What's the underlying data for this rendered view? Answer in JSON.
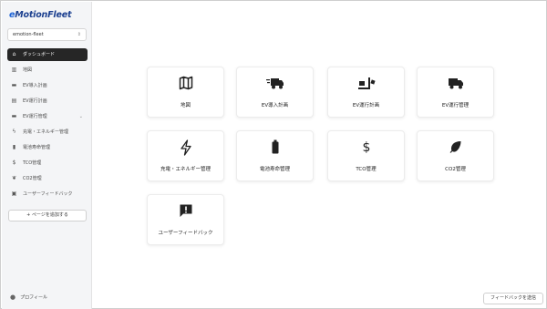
{
  "app": {
    "logo_e": "e",
    "logo_rest": "MotionFleet",
    "workspace": "emotion-fleet"
  },
  "sidebar": {
    "items": [
      {
        "label": "ダッシュボード",
        "icon": "home-icon",
        "active": true
      },
      {
        "label": "地図",
        "icon": "map-icon"
      },
      {
        "label": "EV導入計画",
        "icon": "truck-icon"
      },
      {
        "label": "EV運行計画",
        "icon": "calendar-icon"
      },
      {
        "label": "EV運行管理",
        "icon": "truck-icon",
        "expandable": true
      },
      {
        "label": "充電・エネルギー管理",
        "icon": "bolt-icon"
      },
      {
        "label": "電池寿命管理",
        "icon": "battery-icon"
      },
      {
        "label": "TCO管理",
        "icon": "dollar-icon"
      },
      {
        "label": "CO2管理",
        "icon": "leaf-icon"
      },
      {
        "label": "ユーザーフィードバック",
        "icon": "feedback-icon"
      }
    ],
    "add_page": "+ ページを追加する",
    "profile": "プロフィール"
  },
  "cards": [
    {
      "label": "地図",
      "icon": "map-icon"
    },
    {
      "label": "EV導入計画",
      "icon": "truck-fast-icon"
    },
    {
      "label": "EV運行計画",
      "icon": "truck-loading-icon"
    },
    {
      "label": "EV運行管理",
      "icon": "truck-icon"
    },
    {
      "label": "充電・エネルギー管理",
      "icon": "bolt-icon"
    },
    {
      "label": "電池寿命管理",
      "icon": "battery-icon"
    },
    {
      "label": "TCO管理",
      "icon": "dollar-icon"
    },
    {
      "label": "CO2管理",
      "icon": "leaf-icon"
    },
    {
      "label": "ユーザーフィードバック",
      "icon": "feedback-icon"
    }
  ],
  "feedback_button": "フィードバックを送信",
  "colors": {
    "active_nav_bg": "#262626",
    "logo_blue": "#1e63d6"
  }
}
